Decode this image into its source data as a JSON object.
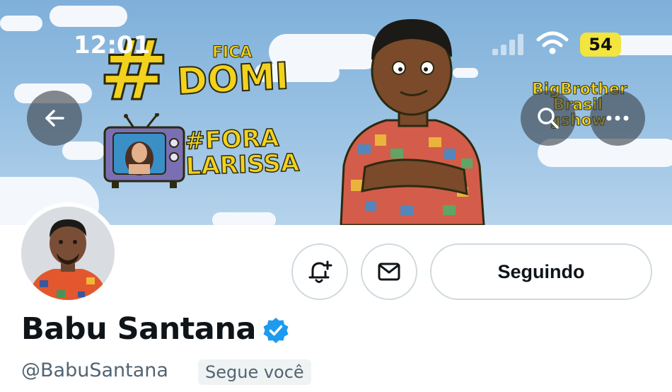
{
  "status_bar": {
    "time": "12:01",
    "battery": "54",
    "colors": {
      "battery_fill": "#f2e53d"
    }
  },
  "header_image": {
    "hashtag_symbol": "#",
    "text_fica": "FICA",
    "text_domi": "DOMI",
    "text_fora_line1": "#FORA",
    "text_fora_line2": "LARISSA",
    "logo_bbb_line1": "BigBrother",
    "logo_bbb_line2": "Brasil",
    "logo_gshow": "gshow"
  },
  "nav": {
    "back_icon": "arrow-left-icon",
    "search_icon": "search-icon",
    "more_icon": "more-horizontal-icon"
  },
  "profile": {
    "display_name": "Babu Santana",
    "handle": "@BabuSantana",
    "follows_you_badge": "Segue você",
    "verified_icon": "verified-badge-icon",
    "colors": {
      "verified": "#1d9bf0",
      "name": "#0f1419",
      "secondary": "#536471"
    }
  },
  "actions": {
    "notify_icon": "bell-plus-icon",
    "message_icon": "mail-icon",
    "following_label": "Seguindo"
  }
}
